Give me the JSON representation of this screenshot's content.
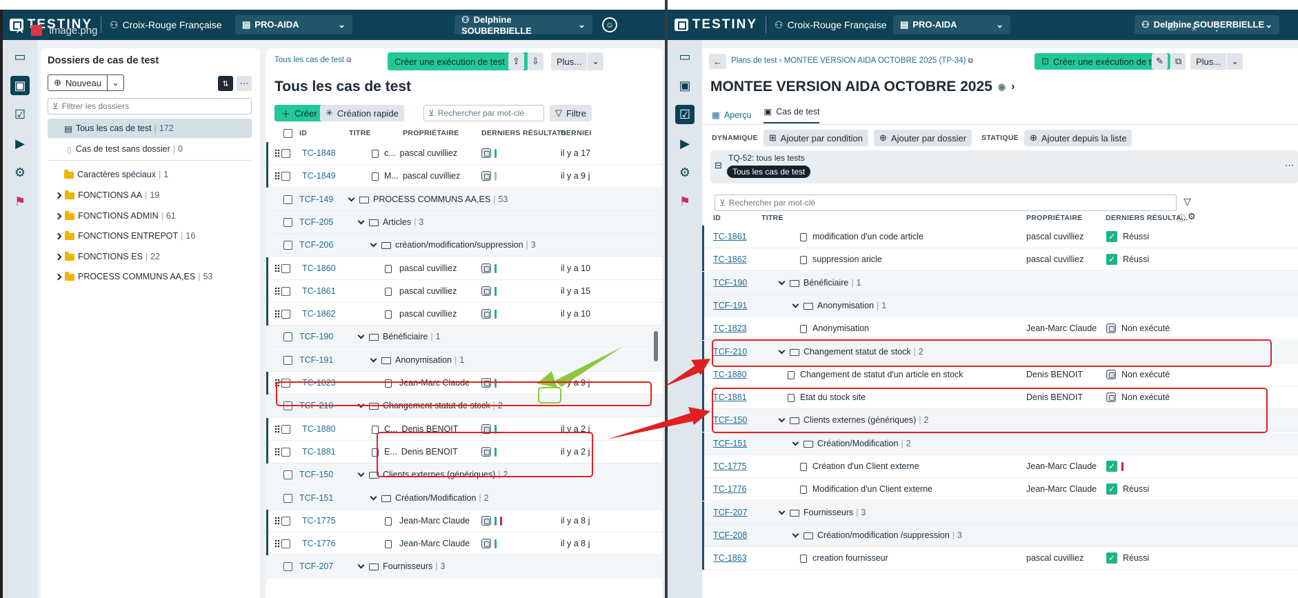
{
  "overlay": {
    "tab_title": "image.png"
  },
  "left": {
    "header": {
      "logo": "TESTINY",
      "org": "Croix-Rouge Française",
      "project": "PRO-AIDA",
      "user": "Delphine SOUBERBIELLE"
    },
    "folders": {
      "title": "Dossiers de cas de test",
      "new_label": "Nouveau",
      "filter_placeholder": "Filtrer les dossiers",
      "items": [
        {
          "label": "Tous les cas de test",
          "count": "172"
        },
        {
          "label": "Cas de test sans dossier",
          "count": "0"
        },
        {
          "label": "Caractères spéciaux",
          "count": "1"
        },
        {
          "label": "FONCTIONS AA",
          "count": "19"
        },
        {
          "label": "FONCTIONS ADMIN",
          "count": "61"
        },
        {
          "label": "FONCTIONS ENTREPOT",
          "count": "16"
        },
        {
          "label": "FONCTIONS ES",
          "count": "22"
        },
        {
          "label": "PROCESS COMMUNS AA,ES",
          "count": "53"
        }
      ]
    },
    "main": {
      "breadcrumb": "Tous les cas de test",
      "create_run": "Créer une exécution de test",
      "more": "Plus...",
      "title": "Tous les cas de test",
      "create": "Créer",
      "quick_create": "Création rapide",
      "search_placeholder": "Rechercher par mot-clé",
      "filter": "Filtre",
      "columns": {
        "id": "ID",
        "title": "TITRE",
        "owner": "PROPRIÉTAIRE",
        "results": "DERNIERS RÉSULTATS",
        "last": "DERNIEI"
      },
      "rows": [
        {
          "kind": "case",
          "id": "TC-1848",
          "title": "c...",
          "owner": "pascal cuvilliez",
          "bars": [
            "#1fb386"
          ],
          "last": "il y a 17"
        },
        {
          "kind": "case",
          "id": "TC-1849",
          "title": "M...",
          "owner": "pascal cuvilliez",
          "bars": [
            "#b0b8bf"
          ],
          "last": "il y a 9 j"
        },
        {
          "kind": "folder",
          "id": "TCF-149",
          "name": "PROCESS COMMUNS AA,ES",
          "count": "53",
          "depth": 0
        },
        {
          "kind": "folder",
          "id": "TCF-205",
          "name": "Articles",
          "count": "3",
          "depth": 1
        },
        {
          "kind": "folder",
          "id": "TCF-206",
          "name": "création/modification/suppression",
          "count": "3",
          "depth": 2
        },
        {
          "kind": "case",
          "id": "TC-1860",
          "title": "",
          "owner": "pascal cuvilliez",
          "bars": [
            "#1fb386"
          ],
          "last": "il y a 10"
        },
        {
          "kind": "case",
          "id": "TC-1861",
          "title": "",
          "owner": "pascal cuvilliez",
          "bars": [
            "#1fb386"
          ],
          "last": "il y a 15"
        },
        {
          "kind": "case",
          "id": "TC-1862",
          "title": "",
          "owner": "pascal cuvilliez",
          "bars": [
            "#1fb386"
          ],
          "last": "il y a 10"
        },
        {
          "kind": "folder",
          "id": "TCF-190",
          "name": "Bénéficiaire",
          "count": "1",
          "depth": 1
        },
        {
          "kind": "folder",
          "id": "TCF-191",
          "name": "Anonymisation",
          "count": "1",
          "depth": 2
        },
        {
          "kind": "case",
          "id": "TC-1823",
          "title": "",
          "owner": "Jean-Marc Claude",
          "bars": [
            "#1fb386"
          ],
          "last": "il y a 9 j"
        },
        {
          "kind": "folder",
          "id": "TCF-210",
          "name": "Changement statut de stock",
          "count": "2",
          "depth": 1
        },
        {
          "kind": "case",
          "id": "TC-1880",
          "title": "C...",
          "owner": "Denis BENOIT",
          "bars": [
            "#1fb386"
          ],
          "last": "il y a 2 j"
        },
        {
          "kind": "case",
          "id": "TC-1881",
          "title": "E...",
          "owner": "Denis BENOIT",
          "bars": [
            "#1fb386"
          ],
          "last": "il y a 2 j"
        },
        {
          "kind": "folder",
          "id": "TCF-150",
          "name": "Clients externes (génériques)",
          "count": "2",
          "depth": 1
        },
        {
          "kind": "folder",
          "id": "TCF-151",
          "name": "Création/Modification",
          "count": "2",
          "depth": 2
        },
        {
          "kind": "case",
          "id": "TC-1775",
          "title": "",
          "owner": "Jean-Marc Claude",
          "bars": [
            "#1fb386",
            "#c8274a"
          ],
          "last": "il y a 8 j"
        },
        {
          "kind": "case",
          "id": "TC-1776",
          "title": "",
          "owner": "Jean-Marc Claude",
          "bars": [
            "#1fb386"
          ],
          "last": "il y a 8 j"
        },
        {
          "kind": "folder",
          "id": "TCF-207",
          "name": "Fournisseurs",
          "count": "3",
          "depth": 1
        }
      ]
    }
  },
  "right": {
    "header": {
      "logo": "TESTINY",
      "org": "Croix-Rouge Française",
      "project": "PRO-AIDA",
      "user": "Delphine SOUBERBIELLE"
    },
    "breadcrumb": "Plans de test › MONTEE VERSION AIDA OCTOBRE 2025 (TP-34)",
    "create_run": "Créer une exécution de test",
    "more": "Plus...",
    "title": "MONTEE VERSION AIDA OCTOBRE 2025",
    "tabs": [
      "Aperçu",
      "Cas de test"
    ],
    "dyn_label": "DYNAMIQUE",
    "add_condition": "Ajouter par condition",
    "add_folder": "Ajouter par dossier",
    "static_label": "STATIQUE",
    "add_list": "Ajouter depuis la liste",
    "query": "TQ-52: tous les tests",
    "query_tag": "Tous les cas de test",
    "search_placeholder": "Rechercher par mot-clé",
    "columns": {
      "id": "ID",
      "title": "TITRE",
      "owner": "PROPRIÉTAIRE",
      "results": "DERNIERS RÉSULTA..."
    },
    "rows": [
      {
        "kind": "case",
        "id": "TC-1861",
        "title": "modification d'un code article",
        "owner": "pascal cuvilliez",
        "status": "passed",
        "status_text": "Réussi"
      },
      {
        "kind": "case",
        "id": "TC-1862",
        "title": "suppression aricle",
        "owner": "pascal cuvilliez",
        "status": "passed",
        "status_text": "Réussi"
      },
      {
        "kind": "folder",
        "id": "TCF-190",
        "name": "Bénéficiaire",
        "count": "1",
        "depth": 0
      },
      {
        "kind": "folder",
        "id": "TCF-191",
        "name": "Anonymisation",
        "count": "1",
        "depth": 1
      },
      {
        "kind": "case",
        "id": "TC-1823",
        "title": "Anonymisation",
        "owner": "Jean-Marc Claude",
        "status": "untested",
        "status_text": "Non exécuté"
      },
      {
        "kind": "folder",
        "id": "TCF-210",
        "name": "Changement statut de stock",
        "count": "2",
        "depth": 0
      },
      {
        "kind": "case",
        "id": "TC-1880",
        "title": "Changement de statut d'un article en stock",
        "owner": "Denis BENOIT",
        "status": "untested",
        "status_text": "Non exécuté"
      },
      {
        "kind": "case",
        "id": "TC-1881",
        "title": "Etat du stock site",
        "owner": "Denis BENOIT",
        "status": "untested",
        "status_text": "Non exécuté"
      },
      {
        "kind": "folder",
        "id": "TCF-150",
        "name": "Clients externes (génériques)",
        "count": "2",
        "depth": 0
      },
      {
        "kind": "folder",
        "id": "TCF-151",
        "name": "Création/Modification",
        "count": "2",
        "depth": 1
      },
      {
        "kind": "case",
        "id": "TC-1775",
        "title": "Création d'un Client externe",
        "owner": "Jean-Marc Claude",
        "status": "passed-failed",
        "status_text": ""
      },
      {
        "kind": "case",
        "id": "TC-1776",
        "title": "Modification d'un Client externe",
        "owner": "Jean-Marc Claude",
        "status": "passed",
        "status_text": "Réussi"
      },
      {
        "kind": "folder",
        "id": "TCF-207",
        "name": "Fournisseurs",
        "count": "3",
        "depth": 0
      },
      {
        "kind": "folder",
        "id": "TCF-208",
        "name": "Création/modification /suppression",
        "count": "3",
        "depth": 1
      },
      {
        "kind": "case",
        "id": "TC-1863",
        "title": "creation fournisseur",
        "owner": "pascal cuvilliez",
        "status": "passed",
        "status_text": "Réussi"
      }
    ]
  },
  "colors": {
    "header": "#0d4155",
    "accent": "#22c79a",
    "passed": "#1fb386",
    "failed": "#c8274a",
    "annotation": "#e02020",
    "arrow_green": "#8dc63f"
  }
}
